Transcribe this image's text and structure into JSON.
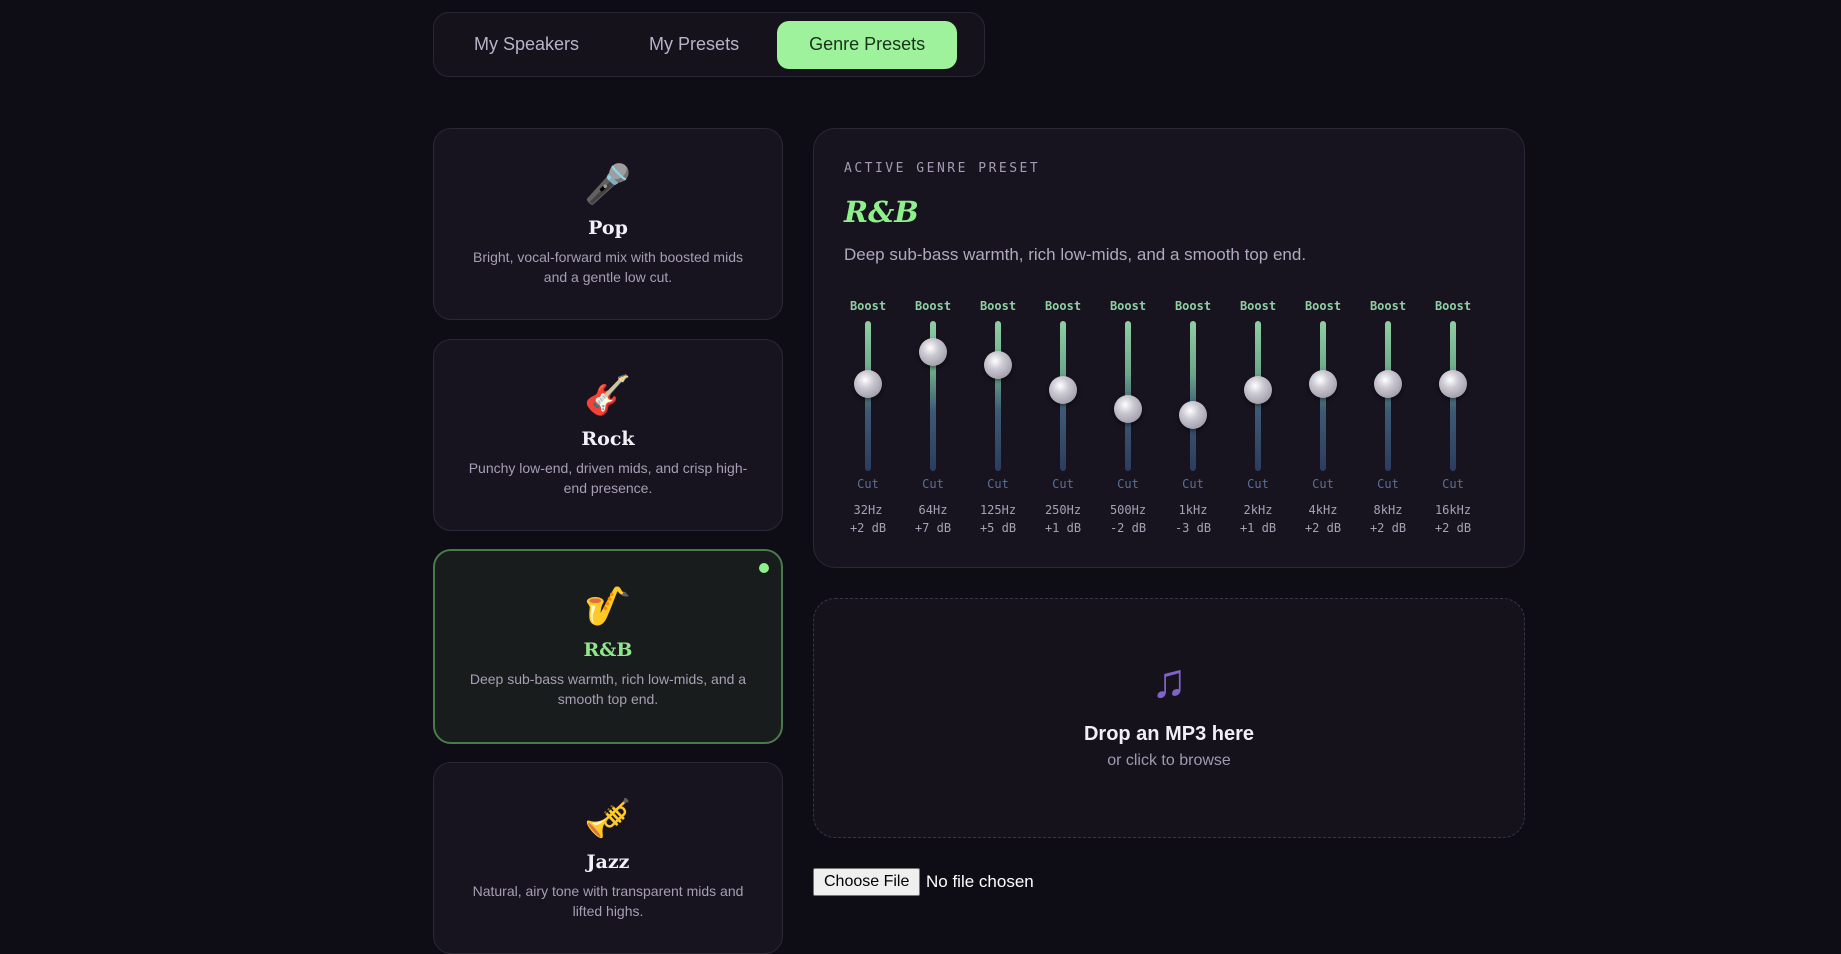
{
  "tabs": [
    {
      "label": "My Speakers",
      "active": false
    },
    {
      "label": "My Presets",
      "active": false
    },
    {
      "label": "Genre Presets",
      "active": true
    }
  ],
  "genres": [
    {
      "icon": "🎤",
      "icon_name": "microphone-icon",
      "name": "Pop",
      "desc": "Bright, vocal-forward mix with boosted mids and a gentle low cut."
    },
    {
      "icon": "🎸",
      "icon_name": "guitar-icon",
      "name": "Rock",
      "desc": "Punchy low-end, driven mids, and crisp high-end presence."
    },
    {
      "icon": "🎷",
      "icon_name": "saxophone-icon",
      "name": "R&B",
      "desc": "Deep sub-bass warmth, rich low-mids, and a smooth top end.",
      "selected": true
    },
    {
      "icon": "🎺",
      "icon_name": "trumpet-icon",
      "name": "Jazz",
      "desc": "Natural, airy tone with transparent mids and lifted highs."
    }
  ],
  "active_preset": {
    "label": "ACTIVE GENRE PRESET",
    "title": "R&B",
    "desc": "Deep sub-bass warmth, rich low-mids, and a smooth top end.",
    "boost_label": "Boost",
    "cut_label": "Cut",
    "range_db": [
      -12,
      12
    ],
    "bands": [
      {
        "freq": "32Hz",
        "gain": 2,
        "gain_label": "+2 dB"
      },
      {
        "freq": "64Hz",
        "gain": 7,
        "gain_label": "+7 dB"
      },
      {
        "freq": "125Hz",
        "gain": 5,
        "gain_label": "+5 dB"
      },
      {
        "freq": "250Hz",
        "gain": 1,
        "gain_label": "+1 dB"
      },
      {
        "freq": "500Hz",
        "gain": -2,
        "gain_label": "-2 dB"
      },
      {
        "freq": "1kHz",
        "gain": -3,
        "gain_label": "-3 dB"
      },
      {
        "freq": "2kHz",
        "gain": 1,
        "gain_label": "+1 dB"
      },
      {
        "freq": "4kHz",
        "gain": 2,
        "gain_label": "+2 dB"
      },
      {
        "freq": "8kHz",
        "gain": 2,
        "gain_label": "+2 dB"
      },
      {
        "freq": "16kHz",
        "gain": 2,
        "gain_label": "+2 dB"
      }
    ]
  },
  "dropzone": {
    "icon": "♫",
    "icon_name": "music-note-icon",
    "title": "Drop an MP3 here",
    "subtitle": "or click to browse"
  },
  "file_input": {
    "button_label": "Choose File",
    "status": "No file chosen"
  },
  "colors": {
    "accent": "#9ef29b",
    "background": "#0e0c14",
    "card": "#17131f"
  }
}
